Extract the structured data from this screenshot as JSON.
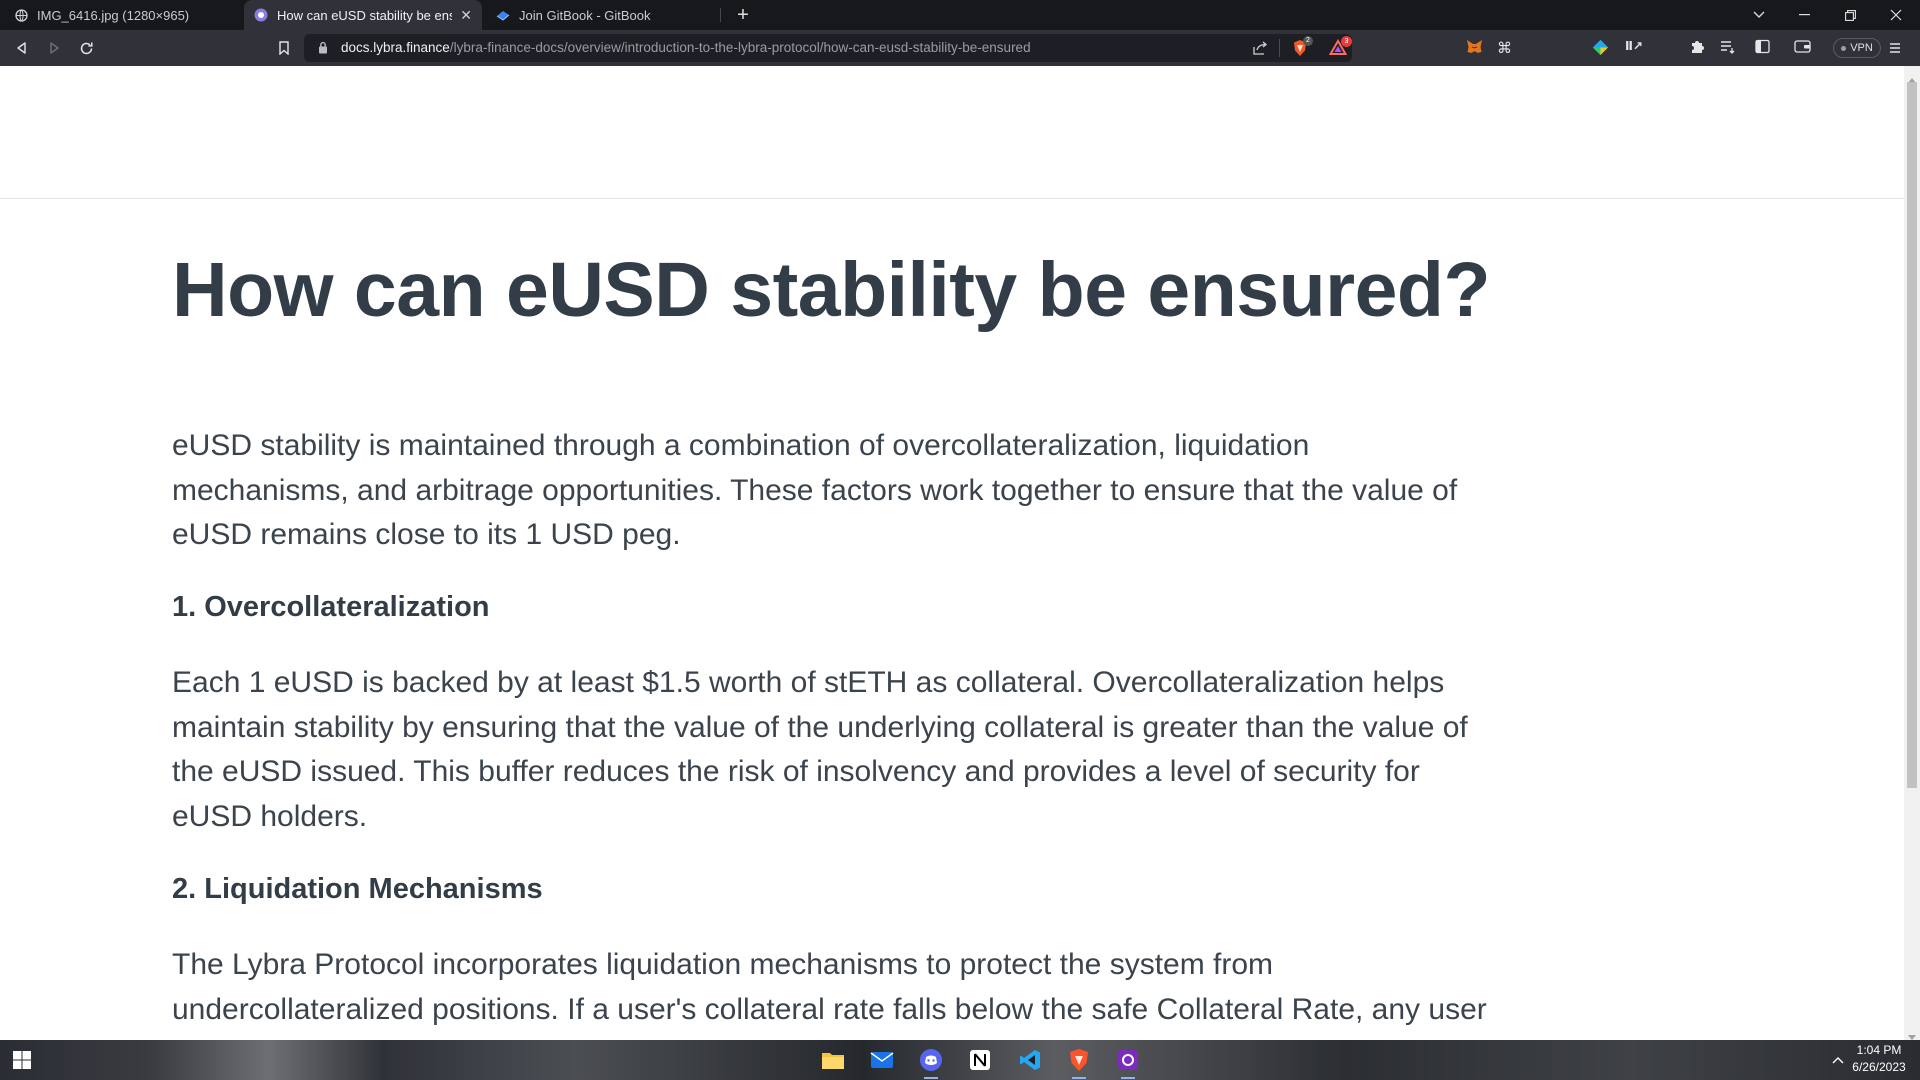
{
  "browser": {
    "tabs": [
      {
        "title": "IMG_6416.jpg (1280×965)",
        "active": false
      },
      {
        "title": "How can eUSD stability be ensure",
        "active": true
      },
      {
        "title": "Join GitBook - GitBook",
        "active": false
      }
    ],
    "url": {
      "host": "docs.lybra.finance",
      "path": "/lybra-finance-docs/overview/introduction-to-the-lybra-protocol/how-can-eusd-stability-be-ensured"
    },
    "badges": {
      "brave_shields": "2",
      "rewards": "3"
    },
    "vpn_label": "VPN"
  },
  "page": {
    "title": "How can eUSD stability be ensured?",
    "intro_lines": [
      "eUSD stability is maintained through a combination of overcollateralization, liquidation",
      "mechanisms, and arbitrage opportunities. These factors work together to ensure that the value of",
      "eUSD remains close to its 1 USD peg."
    ],
    "section1_heading": "1. Overcollateralization",
    "section1_lines": [
      "Each 1 eUSD is backed by at least $1.5 worth of stETH as collateral. Overcollateralization helps",
      "maintain stability by ensuring that the value of the underlying collateral is greater than the value of",
      "the eUSD issued. This buffer reduces the risk of insolvency and provides a level of security for",
      "eUSD holders."
    ],
    "section2_heading": "2. Liquidation Mechanisms",
    "section2_lines": [
      "The Lybra Protocol incorporates liquidation mechanisms to protect the system from",
      "undercollateralized positions. If a user's collateral rate falls below the safe Collateral Rate, any user"
    ]
  },
  "taskbar": {
    "time": "1:04 PM",
    "date": "6/26/2023"
  },
  "colors": {
    "heading": "#333d47",
    "body_text": "#3b434d",
    "tab_bar": "#17181c",
    "toolbar": "#303139"
  }
}
